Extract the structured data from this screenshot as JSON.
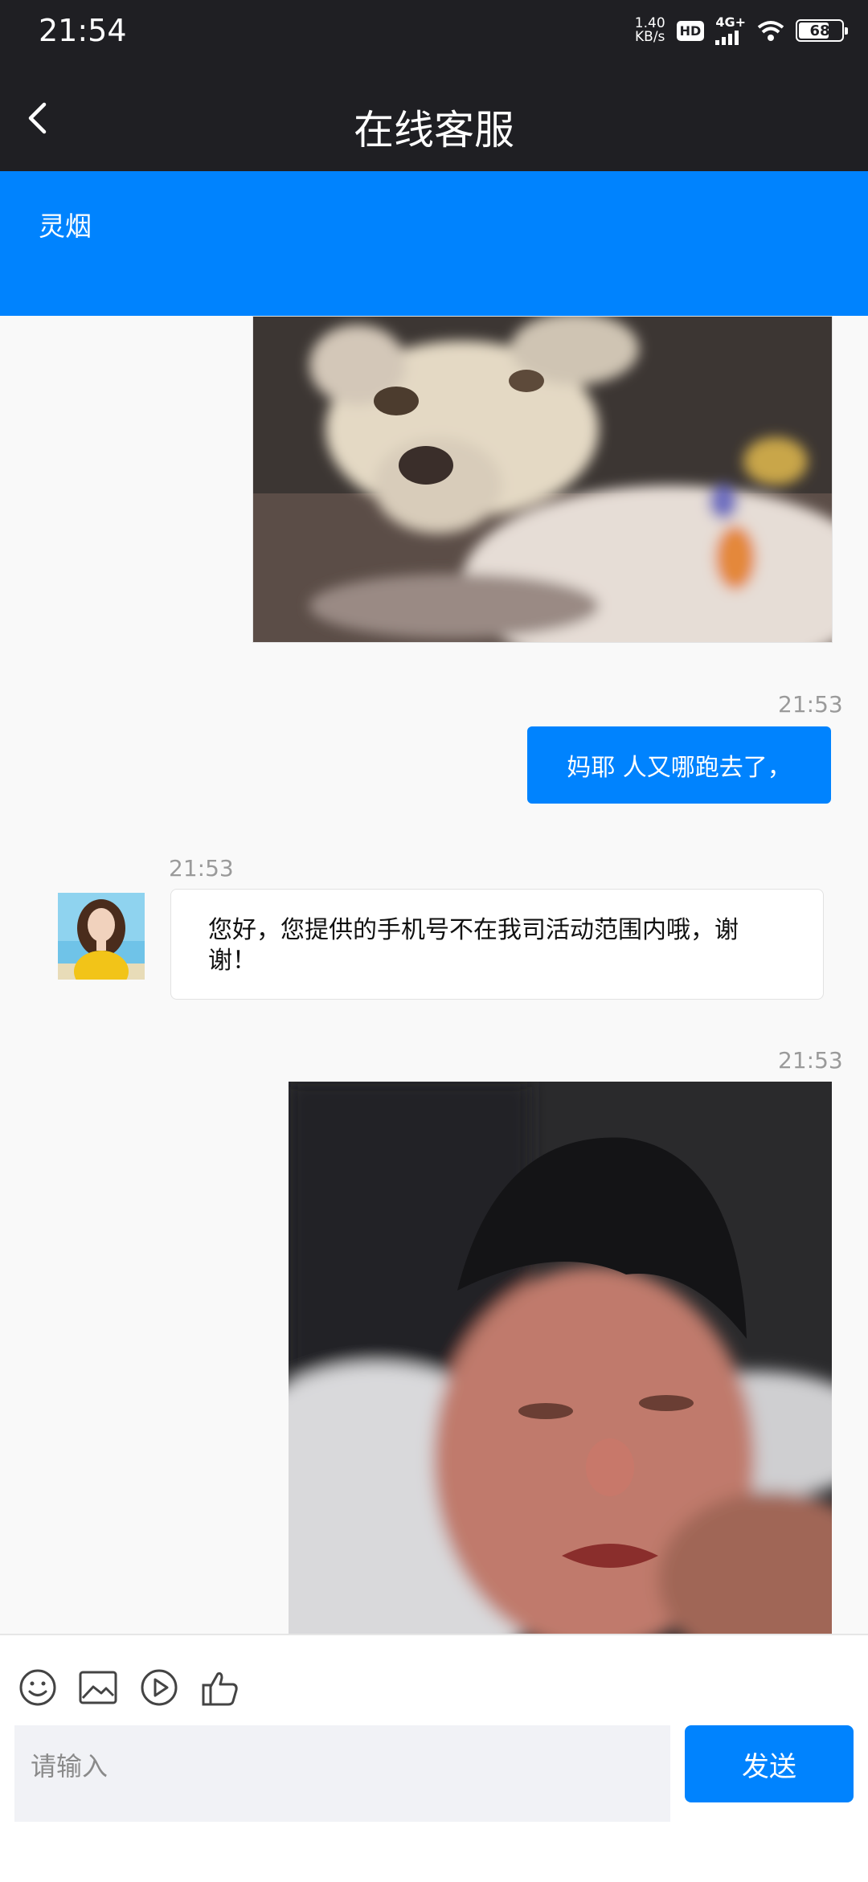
{
  "status_bar": {
    "time": "21:54",
    "net_speed_value": "1.40",
    "net_speed_unit": "KB/s",
    "hd_label": "HD",
    "network_label": "4G+",
    "battery": "68"
  },
  "nav": {
    "title": "在线客服"
  },
  "header": {
    "agent_name": "灵烟"
  },
  "messages": [
    {
      "type": "image",
      "side": "right",
      "icon": "dog-photo"
    },
    {
      "type": "text",
      "side": "right",
      "time": "21:53",
      "text": "妈耶 人又哪跑去了，"
    },
    {
      "type": "text",
      "side": "left",
      "time": "21:53",
      "text": "您好，您提供的手机号不在我司活动范围内哦，谢谢！"
    },
    {
      "type": "image",
      "side": "right",
      "time": "21:53",
      "icon": "crying-man-photo"
    }
  ],
  "input": {
    "placeholder": "请输入",
    "send_label": "发送"
  },
  "toolbar_icons": [
    "emoji-icon",
    "image-icon",
    "video-icon",
    "thumbs-up-icon"
  ],
  "colors": {
    "brand": "#0083fe",
    "bar": "#1f1f23"
  }
}
